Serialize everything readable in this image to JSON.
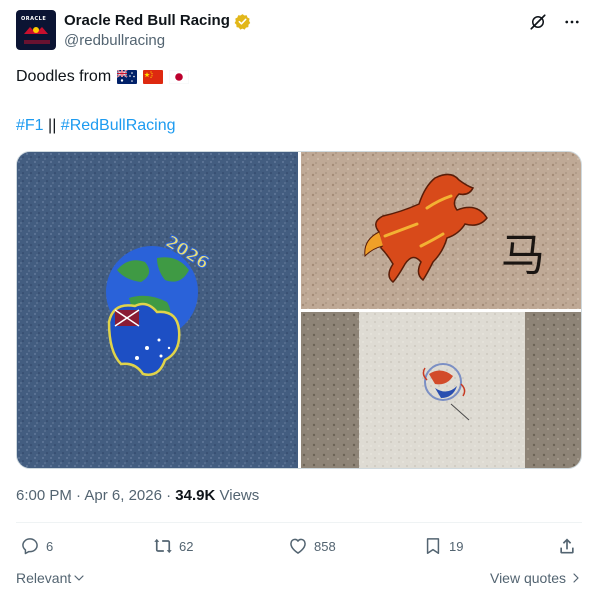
{
  "header": {
    "display_name": "Oracle Red Bull Racing",
    "handle": "@redbullracing",
    "avatar_text": "ORACLE",
    "avatar_subtext": "RACING"
  },
  "tweet": {
    "text": "Doodles from",
    "flags": [
      "Australia flag",
      "China flag",
      "Japan flag"
    ],
    "hashtag1": "#F1",
    "separator": "||",
    "hashtag2": "#RedBullRacing",
    "doodle_number": "2026",
    "doodle_character": "马"
  },
  "meta": {
    "time": "6:00 PM",
    "dot1": "·",
    "date": "Apr 6, 2026",
    "dot2": "·",
    "views_count": "34.9K",
    "views_label": "Views"
  },
  "actions": {
    "replies": "6",
    "reposts": "62",
    "likes": "858",
    "bookmarks": "19"
  },
  "footer": {
    "sort_label": "Relevant",
    "quotes_label": "View quotes"
  },
  "colors": {
    "link": "#1d9bf0",
    "muted": "#536471",
    "verified": "#e2b719"
  }
}
